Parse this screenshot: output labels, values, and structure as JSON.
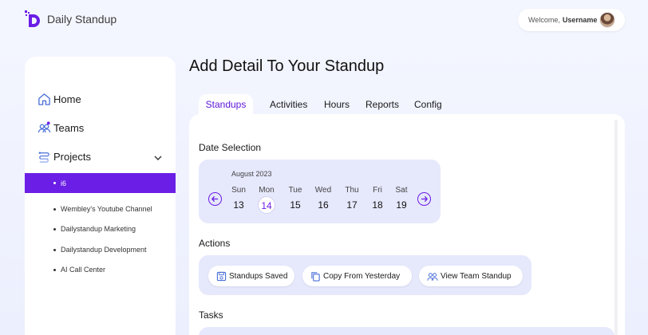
{
  "app": {
    "title": "Daily Standup"
  },
  "user": {
    "welcome": "Welcome,",
    "username": "Username"
  },
  "sidebar": {
    "items": [
      {
        "label": "Home",
        "icon": "home-icon"
      },
      {
        "label": "Teams",
        "icon": "teams-icon"
      },
      {
        "label": "Projects",
        "icon": "projects-icon"
      }
    ],
    "projects": [
      "i6",
      "Wembley's Youtube Channel",
      "Dailystandup Marketing",
      "Dailystandup Development",
      "AI Call Center"
    ],
    "active_project": "i6"
  },
  "main": {
    "title": "Add Detail To Your Standup",
    "tabs": [
      "Standups",
      "Activities",
      "Hours",
      "Reports",
      "Config"
    ],
    "active_tab": "Standups"
  },
  "date_selection": {
    "title": "Date Selection",
    "month": "August 2023",
    "days": [
      {
        "name": "Sun",
        "date": "13"
      },
      {
        "name": "Mon",
        "date": "14"
      },
      {
        "name": "Tue",
        "date": "15"
      },
      {
        "name": "Wed",
        "date": "16"
      },
      {
        "name": "Thu",
        "date": "17"
      },
      {
        "name": "Fri",
        "date": "18"
      },
      {
        "name": "Sat",
        "date": "19"
      }
    ],
    "selected": "14"
  },
  "actions": {
    "title": "Actions",
    "buttons": [
      "Standups Saved",
      "Copy From Yesterday",
      "View Team Standup"
    ]
  },
  "tasks": {
    "title": "Tasks"
  },
  "colors": {
    "accent": "#6b1ee6",
    "panel_bg": "#e6e8fc",
    "page_bg": "#f0f2fe"
  }
}
